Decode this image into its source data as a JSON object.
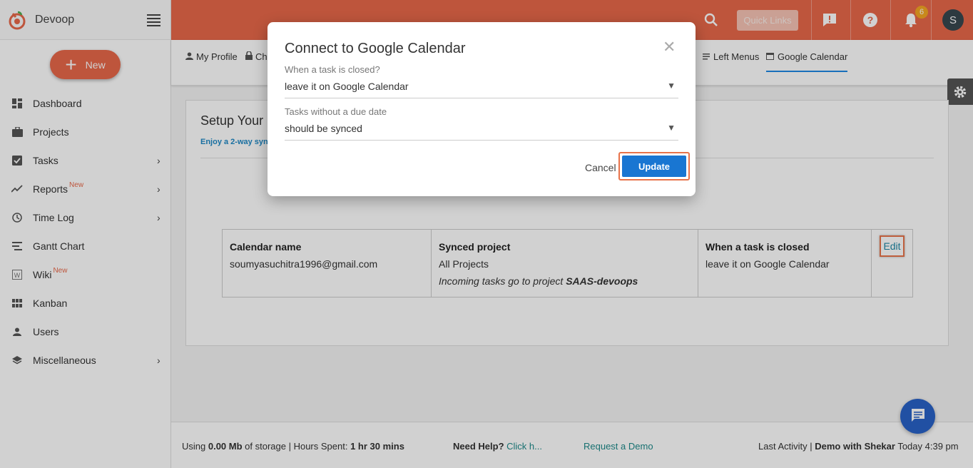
{
  "brand": {
    "name": "Devoop"
  },
  "sidebar": {
    "new_label": "New",
    "items": [
      {
        "label": "Dashboard",
        "icon": "dashboard-icon",
        "badge": "",
        "chevron": false
      },
      {
        "label": "Projects",
        "icon": "briefcase-icon",
        "badge": "",
        "chevron": false
      },
      {
        "label": "Tasks",
        "icon": "checkbox-icon",
        "badge": "",
        "chevron": true
      },
      {
        "label": "Reports",
        "icon": "trending-icon",
        "badge": "New",
        "chevron": true
      },
      {
        "label": "Time Log",
        "icon": "clock-icon",
        "badge": "",
        "chevron": true
      },
      {
        "label": "Gantt Chart",
        "icon": "gantt-icon",
        "badge": "",
        "chevron": false
      },
      {
        "label": "Wiki",
        "icon": "wiki-icon",
        "badge": "New",
        "chevron": false
      },
      {
        "label": "Kanban",
        "icon": "kanban-icon",
        "badge": "",
        "chevron": false
      },
      {
        "label": "Users",
        "icon": "user-icon",
        "badge": "",
        "chevron": false
      },
      {
        "label": "Miscellaneous",
        "icon": "layers-icon",
        "badge": "",
        "chevron": true
      }
    ]
  },
  "topbar": {
    "quick_links": "Quick Links",
    "notification_count": "6",
    "avatar_initial": "S"
  },
  "subtabs": {
    "my_profile": "My Profile",
    "change": "Ch",
    "left_menus": "Left Menus",
    "google_calendar": "Google Calendar"
  },
  "panel": {
    "title": "Setup Your",
    "subtitle": "Enjoy a 2-way syn",
    "table": {
      "col1_header": "Calendar name",
      "col1_value": "soumyasuchitra1996@gmail.com",
      "col2_header": "Synced project",
      "col2_value": "All Projects",
      "col2_note_prefix": "Incoming tasks go to project ",
      "col2_note_project": "SAAS-devoops",
      "col3_header": "When a task is closed",
      "col3_value": "leave it on Google Calendar",
      "edit_label": "Edit"
    }
  },
  "footer": {
    "storage_prefix": "Using ",
    "storage_value": "0.00 Mb",
    "storage_suffix": " of storage | Hours Spent: ",
    "hours_value": "1 hr 30 mins",
    "help_label": "Need Help?",
    "help_link": " Click h...",
    "demo_link": "Request a Demo",
    "last_activity_prefix": "Last Activity | ",
    "last_activity_value": "Demo with Shekar",
    "last_activity_time": " Today 4:39 pm"
  },
  "modal": {
    "title": "Connect to Google Calendar",
    "field1_label": "When a task is closed?",
    "field1_value": "leave it on Google Calendar",
    "field2_label": "Tasks without a due date",
    "field2_value": "should be synced",
    "cancel_label": "Cancel",
    "update_label": "Update"
  },
  "colors": {
    "accent": "#e8684a",
    "primary": "#1976d2",
    "highlight": "#e8734a"
  }
}
